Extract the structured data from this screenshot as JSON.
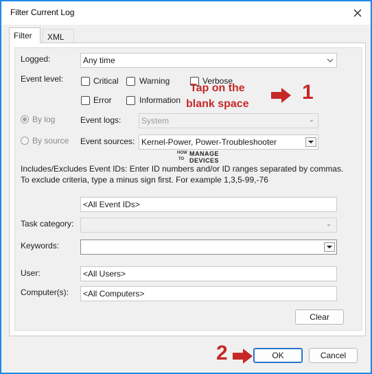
{
  "window": {
    "title": "Filter Current Log"
  },
  "tabs": [
    {
      "label": "Filter"
    },
    {
      "label": "XML"
    }
  ],
  "filter": {
    "logged_label": "Logged:",
    "logged_value": "Any time",
    "event_level_label": "Event level:",
    "levels": {
      "critical": "Critical",
      "warning": "Warning",
      "verbose": "Verbose",
      "error": "Error",
      "information": "Information"
    },
    "by_log_label": "By log",
    "by_source_label": "By source",
    "event_logs_label": "Event logs:",
    "event_logs_value": "System",
    "event_sources_label": "Event sources:",
    "event_sources_value": "Kernel-Power, Power-Troubleshooter",
    "description": "Includes/Excludes Event IDs: Enter ID numbers and/or ID ranges separated by commas. To exclude criteria, type a minus sign first. For example 1,3,5-99,-76",
    "event_ids_value": "<All Event IDs>",
    "task_category_label": "Task category:",
    "task_category_value": "",
    "keywords_label": "Keywords:",
    "keywords_value": "",
    "user_label": "User:",
    "user_value": "<All Users>",
    "computer_label": "Computer(s):",
    "computer_value": "<All Computers>",
    "clear_label": "Clear"
  },
  "footer": {
    "ok_label": "OK",
    "cancel_label": "Cancel"
  },
  "annotations": {
    "callout_line1": "Tap on the",
    "callout_line2": "blank space",
    "step1": "1",
    "step2": "2",
    "watermark_how": "HOW",
    "watermark_to": "TO",
    "watermark_manage": "MANAGE",
    "watermark_devices": "DEVICES",
    "accent_color": "#c62828"
  }
}
